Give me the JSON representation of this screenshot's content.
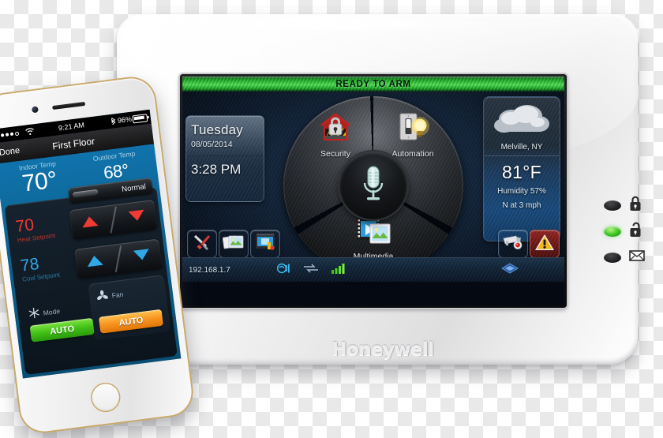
{
  "scene": {
    "description": "Honeywell Tuxedo Touch security panel beside a white gold iPhone showing a thermostat app"
  },
  "panel": {
    "brand": "Honeywell",
    "status_banner": "READY TO ARM",
    "date_panel": {
      "day_of_week": "Tuesday",
      "date": "08/05/2014",
      "time": "3:28 PM"
    },
    "weather": {
      "icon": "cloudy-icon",
      "location": "Melville, NY",
      "temperature": "81°F",
      "humidity": "Humidity 57%",
      "wind": "N at 3 mph"
    },
    "dial": {
      "center_icon": "microphone-icon",
      "items": [
        {
          "label": "Security",
          "icon": "house-lock-icon"
        },
        {
          "label": "Automation",
          "icon": "light-switch-bulb-icon"
        },
        {
          "label": "Multimedia",
          "icon": "film-photo-icon"
        }
      ]
    },
    "tray": [
      {
        "name": "tools-tile",
        "icon": "screwdriver-tools-icon"
      },
      {
        "name": "photos-tile",
        "icon": "photos-icon"
      },
      {
        "name": "system-info-tile",
        "icon": "monitor-info-icon"
      },
      {
        "name": "camera-tile",
        "icon": "security-camera-icon"
      },
      {
        "name": "panic-tile",
        "icon": "warning-triangle-icon"
      }
    ],
    "status_bar": {
      "ip_address": "192.168.1.7",
      "icons": [
        {
          "name": "sound-icon"
        },
        {
          "name": "network-transfer-icon"
        },
        {
          "name": "signal-bars-icon"
        },
        {
          "name": "zwave-diamond-icon"
        }
      ]
    },
    "leds": [
      {
        "icon": "padlock-closed-icon",
        "state": "off"
      },
      {
        "icon": "padlock-open-icon",
        "state": "on",
        "color": "#3fcc28"
      },
      {
        "icon": "envelope-icon",
        "state": "off"
      }
    ]
  },
  "phone": {
    "status_bar": {
      "signal_dots": 5,
      "wifi": "wifi-icon",
      "time": "9:21 AM",
      "bluetooth": "bluetooth-icon",
      "battery_pct": "96%"
    },
    "nav_bar": {
      "back_label": "Done",
      "title": "First Floor"
    },
    "thermostat": {
      "indoor_label": "Indoor Temp",
      "indoor_value": "70°",
      "outdoor_label": "Outdoor Temp",
      "outdoor_value": "68°",
      "status": "Normal",
      "heat_setpoint_value": "70",
      "heat_setpoint_label": "Heat Setpoint",
      "cool_setpoint_value": "78",
      "cool_setpoint_label": "Cool Setpoint",
      "mode_label": "Mode",
      "mode_value": "AUTO",
      "mode_color": "#3fbf15",
      "fan_label": "Fan",
      "fan_value": "AUTO",
      "fan_color": "#f7921e"
    }
  }
}
